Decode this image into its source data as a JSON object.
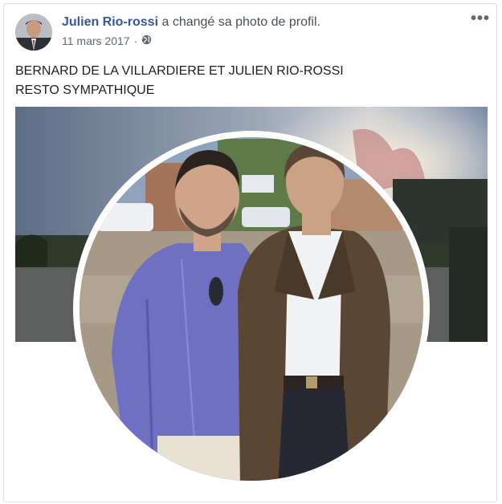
{
  "post": {
    "author": "Julien Rio-rossi",
    "action": "a changé sa photo de profil.",
    "date": "11 mars 2017",
    "separator": "·",
    "privacy_icon": "globe-icon",
    "more_label": "•••"
  },
  "caption": {
    "line1": "BERNARD DE LA VILLARDIERE ET JULIEN RIO-ROSSI",
    "line2": "RESTO SYMPATHIQUE"
  },
  "colors": {
    "author_link": "#365899",
    "meta_text": "#616770"
  }
}
